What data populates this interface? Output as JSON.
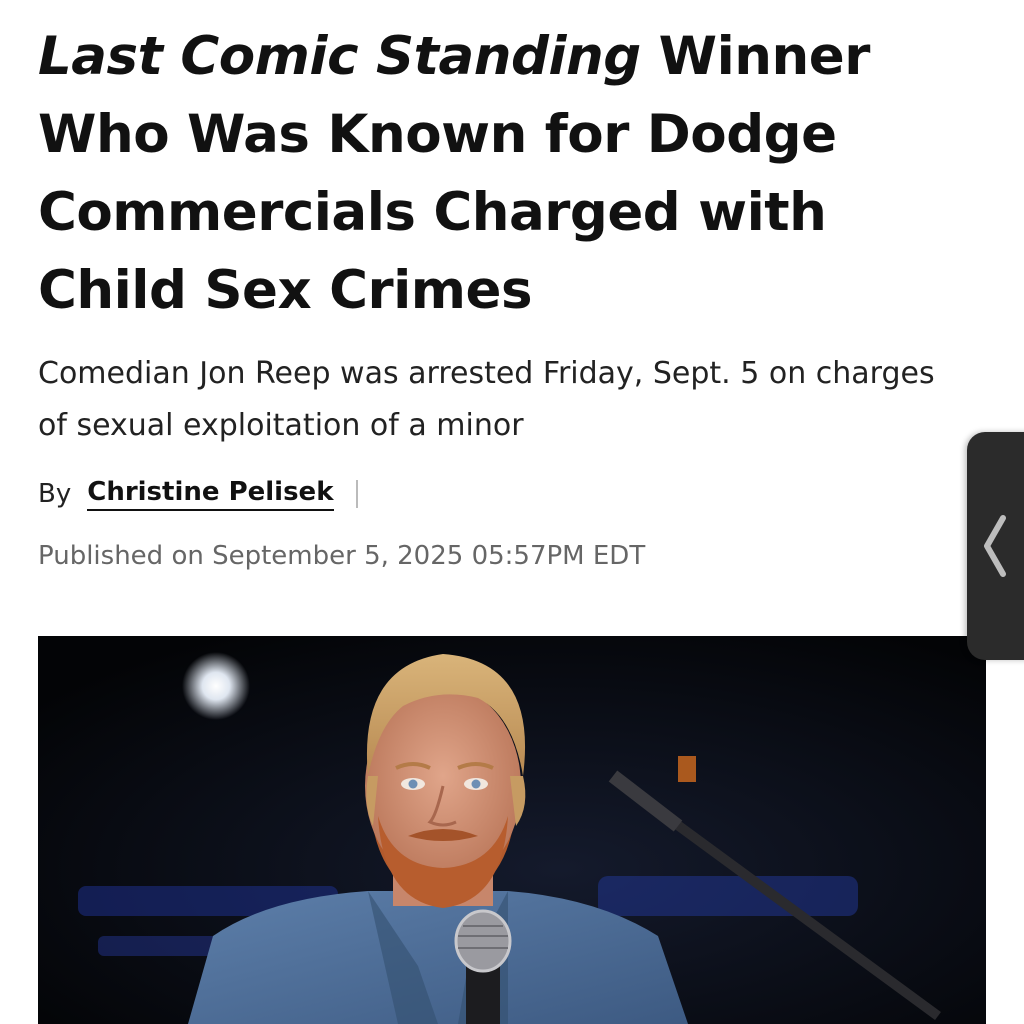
{
  "article": {
    "headline_italic": "Last Comic Standing",
    "headline_rest": " Winner Who Was Known for Dodge Commercials Charged with Child Sex Crimes",
    "dek": "Comedian Jon Reep was arrested Friday, Sept. 5 on charges of sexual exploitation of a minor",
    "byline_prefix": "By",
    "author": "Christine Pelisek",
    "published": "Published on September 5, 2025 05:57PM EDT"
  },
  "hero_image": {
    "subject": "comedian-on-stage-with-microphone"
  },
  "edge_panel": {
    "icon": "chevron-left-icon"
  },
  "colors": {
    "text": "#111111",
    "muted": "#666666",
    "handle": "#2b2b2b"
  }
}
